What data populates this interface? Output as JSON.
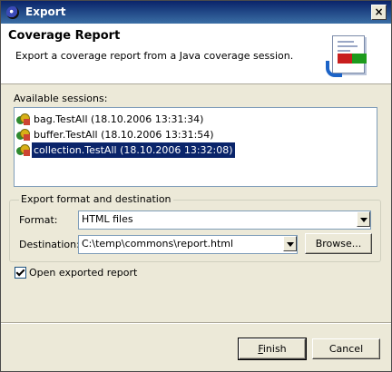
{
  "window": {
    "title": "Export",
    "close_label": "×"
  },
  "header": {
    "title": "Coverage Report",
    "description": "Export a coverage report from a Java coverage session."
  },
  "sessions": {
    "label": "Available sessions:",
    "items": [
      {
        "label": "bag.TestAll (18.10.2006 13:31:34)",
        "selected": false
      },
      {
        "label": "buffer.TestAll (18.10.2006 13:31:54)",
        "selected": false
      },
      {
        "label": "collection.TestAll (18.10.2006 13:32:08)",
        "selected": true
      }
    ]
  },
  "export": {
    "group_label": "Export format and destination",
    "format_label": "Format:",
    "format_value": "HTML files",
    "destination_label": "Destination:",
    "destination_value": "C:\\temp\\commons\\report.html",
    "browse_label": "Browse..."
  },
  "options": {
    "open_report_label": "Open exported report",
    "open_report_checked": true
  },
  "buttons": {
    "finish_mnemonic": "F",
    "finish_rest": "inish",
    "cancel": "Cancel"
  },
  "colors": {
    "selection": "#0a246a",
    "title_bar": "#0a246a",
    "dialog_bg": "#ece9d8"
  }
}
